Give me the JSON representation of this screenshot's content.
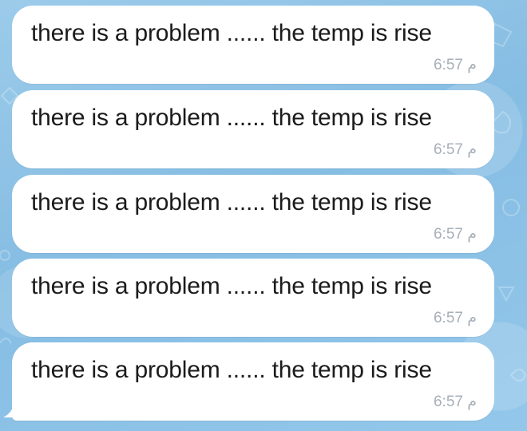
{
  "chat": {
    "background_color": "#8fc3e6",
    "bubble_color": "#ffffff",
    "messages": [
      {
        "text": "there is a problem ...... the temp is rise",
        "time": "6:57 م"
      },
      {
        "text": "there is a problem ...... the temp is rise",
        "time": "6:57 م"
      },
      {
        "text": "there is a problem ...... the temp is rise",
        "time": "6:57 م"
      },
      {
        "text": "there is a problem ...... the temp is rise",
        "time": "6:57 م"
      },
      {
        "text": "there is a problem ...... the temp is rise",
        "time": "6:57 م"
      }
    ]
  }
}
